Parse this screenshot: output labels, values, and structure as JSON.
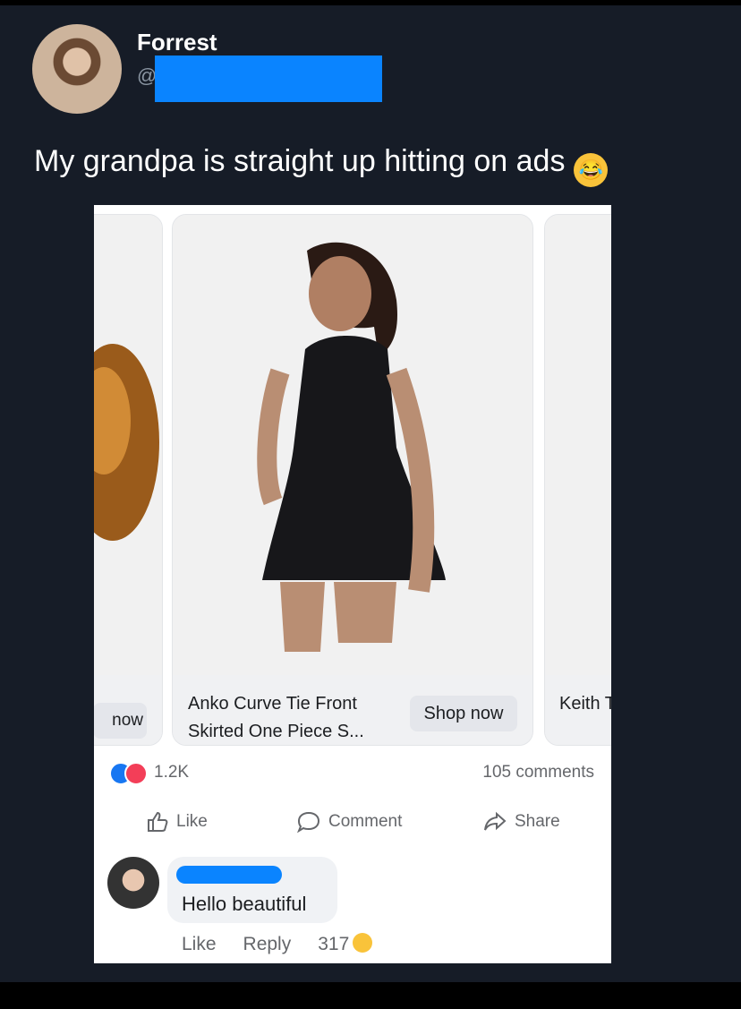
{
  "tweet": {
    "username": "Forrest",
    "handle_prefix": "@",
    "text": "My grandpa is straight up hitting on ads",
    "emoji": "😂"
  },
  "ad": {
    "left_card_button": "now",
    "product_title": "Anko Curve Tie Front Skirted One Piece S...",
    "shop_button": "Shop now",
    "right_card_title": "Keith T-shir"
  },
  "post": {
    "reactions_count": "1.2K",
    "comments_count": "105 comments",
    "actions": {
      "like": "Like",
      "comment": "Comment",
      "share": "Share"
    }
  },
  "comment": {
    "text": "Hello beautiful",
    "like": "Like",
    "reply": "Reply",
    "reaction_count": "317"
  },
  "colors": {
    "redaction": "#0a84ff",
    "background": "#161c27"
  }
}
